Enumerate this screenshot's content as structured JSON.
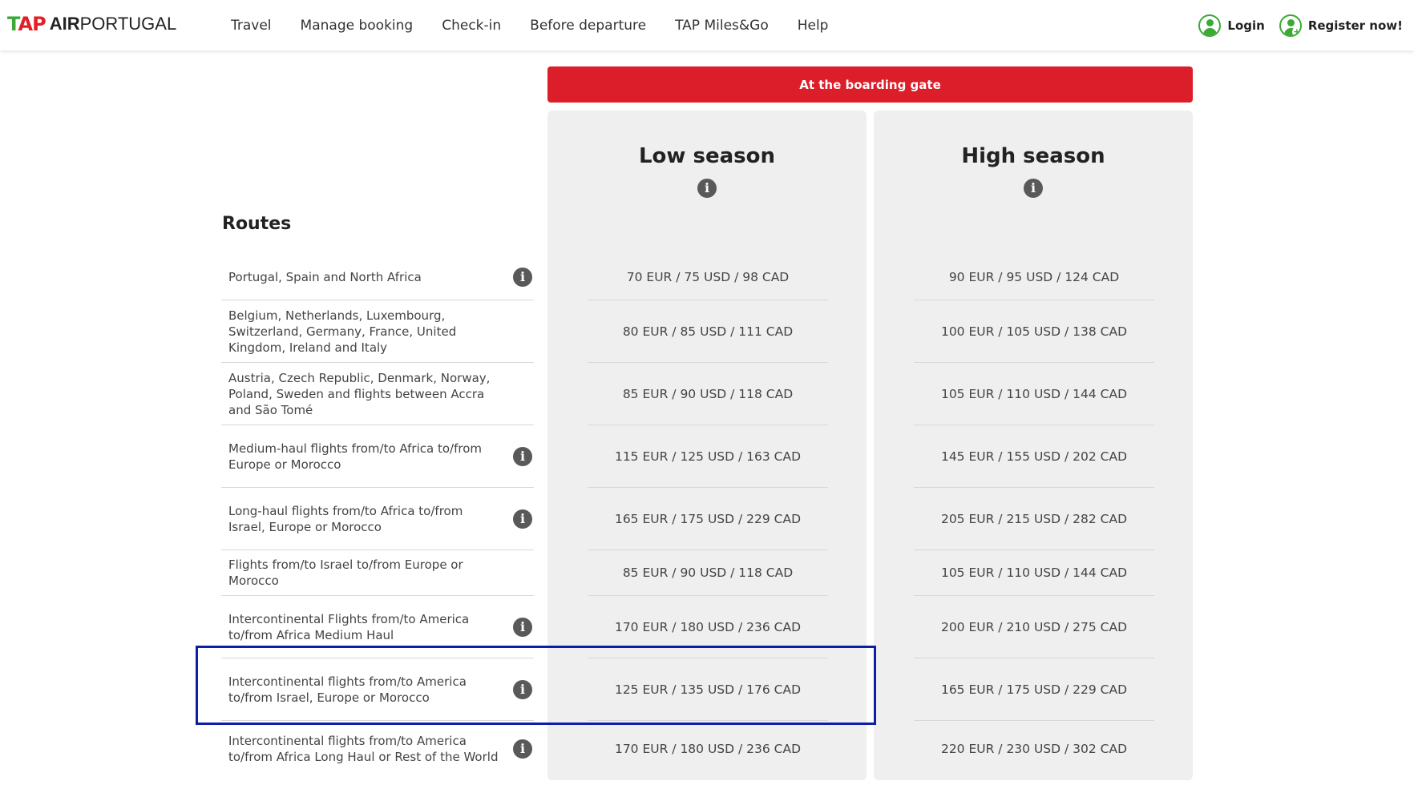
{
  "header": {
    "logo": {
      "tap": "TAP",
      "air": "AIR",
      "portugal": "PORTUGAL"
    },
    "nav": [
      "Travel",
      "Manage booking",
      "Check-in",
      "Before departure",
      "TAP Miles&Go",
      "Help"
    ],
    "login_label": "Login",
    "register_label": "Register now!"
  },
  "table": {
    "gate_label": "At the boarding gate",
    "routes_title": "Routes",
    "low_season_title": "Low season",
    "high_season_title": "High season",
    "rows": [
      {
        "route": "Portugal, Spain and North Africa",
        "low": "70 EUR / 75 USD / 98 CAD",
        "high": "90 EUR / 95 USD / 124 CAD",
        "info": true
      },
      {
        "route": "Belgium, Netherlands, Luxembourg, Switzerland, Germany, France, United Kingdom, Ireland and Italy",
        "low": "80 EUR / 85 USD / 111 CAD",
        "high": "100 EUR / 105 USD / 138 CAD",
        "info": false
      },
      {
        "route": "Austria, Czech Republic, Denmark, Norway, Poland, Sweden and flights between Accra and São Tomé",
        "low": "85 EUR / 90 USD / 118 CAD",
        "high": "105 EUR / 110 USD / 144 CAD",
        "info": false
      },
      {
        "route": "Medium-haul flights from/to Africa to/from Europe or Morocco",
        "low": "115 EUR / 125 USD / 163 CAD",
        "high": "145 EUR / 155 USD / 202 CAD",
        "info": true
      },
      {
        "route": "Long-haul flights from/to Africa to/from Israel, Europe or Morocco",
        "low": "165 EUR / 175 USD / 229 CAD",
        "high": "205 EUR / 215 USD / 282 CAD",
        "info": true
      },
      {
        "route": "Flights from/to Israel to/from Europe or Morocco",
        "low": "85 EUR / 90 USD / 118 CAD",
        "high": "105 EUR / 110 USD / 144 CAD",
        "info": false
      },
      {
        "route": "Intercontinental Flights from/to America to/from Africa Medium Haul",
        "low": "170 EUR / 180 USD / 236 CAD",
        "high": "200 EUR / 210 USD / 275 CAD",
        "info": true
      },
      {
        "route": "Intercontinental flights from/to America to/from Israel, Europe or Morocco",
        "low": "125 EUR / 135 USD / 176 CAD",
        "high": "165 EUR / 175 USD / 229 CAD",
        "info": true
      },
      {
        "route": "Intercontinental flights from/to America to/from Africa Long Haul or Rest of the World",
        "low": "170 EUR / 180 USD / 236 CAD",
        "high": "220 EUR / 230 USD / 302 CAD",
        "info": true
      }
    ]
  },
  "colors": {
    "brand_red": "#dc1d2a",
    "brand_green": "#3ba935",
    "highlight": "#0b1fa8"
  },
  "icons": {
    "info": "i"
  }
}
